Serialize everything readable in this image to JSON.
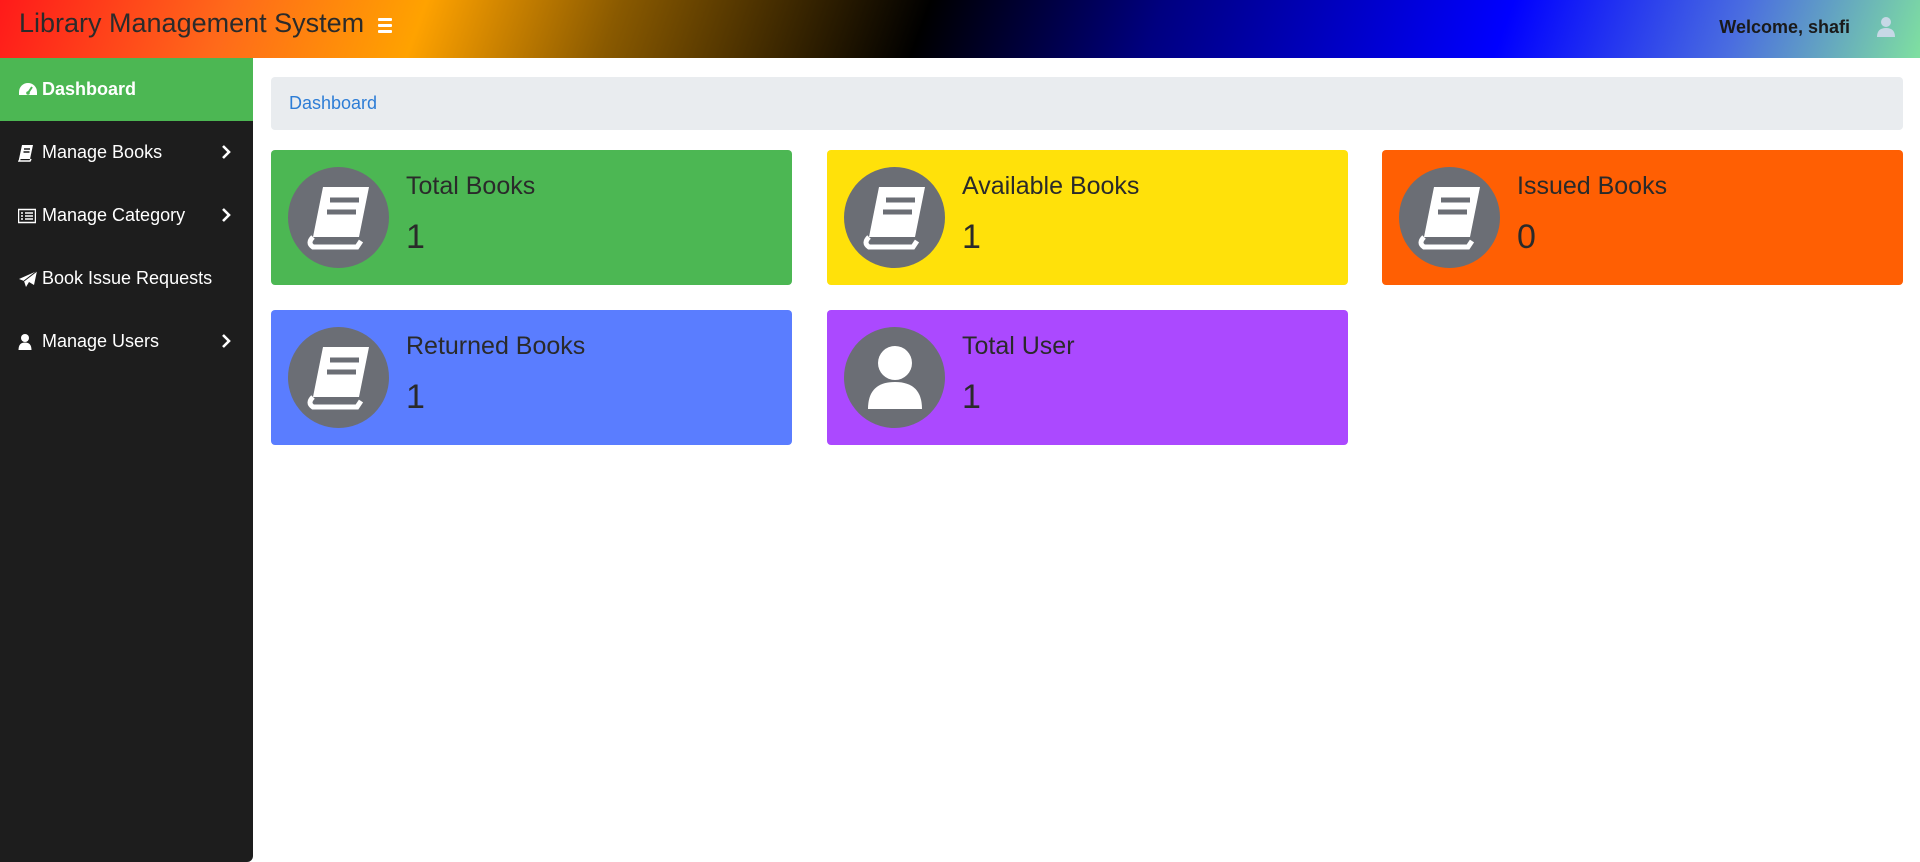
{
  "header": {
    "brand": "Library Management System",
    "welcome": "Welcome, shafi"
  },
  "sidebar": {
    "items": [
      {
        "label": "Dashboard",
        "icon": "gauge-icon",
        "active": true
      },
      {
        "label": "Manage Books",
        "icon": "book-icon",
        "has_submenu": true
      },
      {
        "label": "Manage Category",
        "icon": "list-icon",
        "has_submenu": true
      },
      {
        "label": "Book Issue Requests",
        "icon": "paper-plane-icon"
      },
      {
        "label": "Manage Users",
        "icon": "user-icon",
        "has_submenu": true
      }
    ]
  },
  "breadcrumb": {
    "label": "Dashboard"
  },
  "cards": [
    {
      "title": "Total Books",
      "value": "1",
      "color": "#4cb753",
      "icon": "book-icon"
    },
    {
      "title": "Available Books",
      "value": "1",
      "color": "#ffe10a",
      "icon": "book-icon"
    },
    {
      "title": "Issued Books",
      "value": "0",
      "color": "#ff5f03",
      "icon": "book-icon"
    },
    {
      "title": "Returned Books",
      "value": "1",
      "color": "#5a7dff",
      "icon": "book-icon"
    },
    {
      "title": "Total User",
      "value": "1",
      "color": "#ab49ff",
      "icon": "user-icon"
    }
  ]
}
